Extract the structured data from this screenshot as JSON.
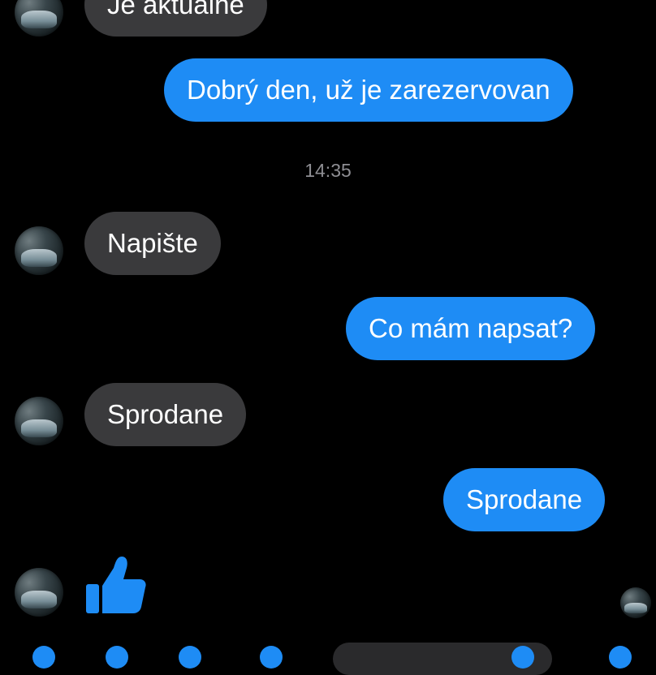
{
  "messages": [
    {
      "side": "in",
      "text": "Je aktuálne"
    },
    {
      "side": "out",
      "text": "Dobrý den, už je zarezervovan"
    },
    {
      "side": "in",
      "text": "Napište"
    },
    {
      "side": "out",
      "text": "Co mám napsat?"
    },
    {
      "side": "in",
      "text": "Sprodane"
    },
    {
      "side": "out",
      "text": "Sprodane"
    }
  ],
  "timestamp": "14:35",
  "colors": {
    "background": "#000000",
    "incoming_bubble": "#3a3a3c",
    "outgoing_bubble": "#1e8cf5",
    "timestamp_text": "#8e8e93"
  },
  "icons": {
    "reaction": "thumbs-up-icon",
    "avatar": "contact-avatar",
    "read_receipt": "read-receipt-avatar"
  }
}
